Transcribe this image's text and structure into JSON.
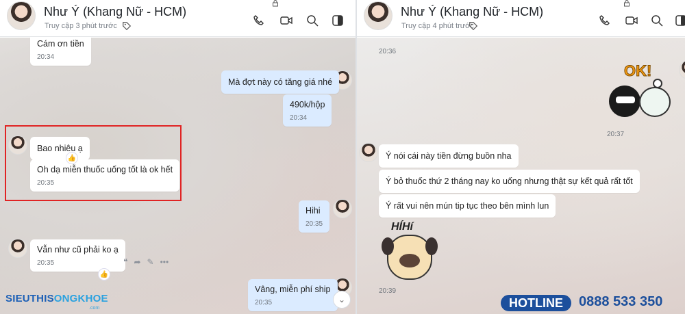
{
  "left": {
    "header": {
      "name": "Như Ý (Khang Nữ - HCM)",
      "status": "Truy cập 3 phút trước"
    },
    "messages": [
      {
        "text": "Cám ơn tiền",
        "time": "20:34"
      },
      {
        "text": "Mà đợt này có tăng giá nhé"
      },
      {
        "text": "490k/hộp",
        "time": "20:34"
      },
      {
        "text": "Bao nhiêu ạ"
      },
      {
        "text": "Oh dạ miễn thuốc uống tốt là ok hết",
        "time": "20:35"
      },
      {
        "text": "Hihi",
        "time": "20:35"
      },
      {
        "text": "Vẫn như cũ phải ko ạ",
        "time": "20:35"
      },
      {
        "text": "Vâng, miễn phí ship",
        "time": "20:35"
      }
    ]
  },
  "right": {
    "header": {
      "name": "Như Ý (Khang Nữ - HCM)",
      "status": "Truy cập 4 phút trước"
    },
    "times": {
      "t1": "20:36",
      "t2": "20:37",
      "t3": "20:39"
    },
    "messages": [
      {
        "text": "Ý nói cái này tiền đừng buồn nha"
      },
      {
        "text": "Ý bỏ thuốc thứ 2 tháng nay ko uống nhưng thật sự kết quả rất tốt"
      },
      {
        "text": "Ý rất vui nên mún tip tục theo bên mình lun"
      }
    ],
    "stickers": {
      "ok": "OK!",
      "hihi": "HÍHí"
    }
  },
  "watermark": {
    "brand_a": "SIEUTHIS",
    "brand_b": "ONGKHOE",
    "sub": ".com"
  },
  "hotline": {
    "label": "HOTLINE",
    "number": "0888 533 350"
  },
  "icons": [
    "phone-icon",
    "video-icon",
    "search-icon",
    "sidebar-toggle-icon",
    "tag-icon",
    "lock-icon",
    "like-icon",
    "quote-icon",
    "forward-icon",
    "edit-icon",
    "more-icon",
    "chevron-down-icon"
  ],
  "colors": {
    "my_bubble": "#dbebff",
    "their_bubble": "#ffffff",
    "highlight": "#e02424",
    "hotline": "#1c4f9c"
  }
}
